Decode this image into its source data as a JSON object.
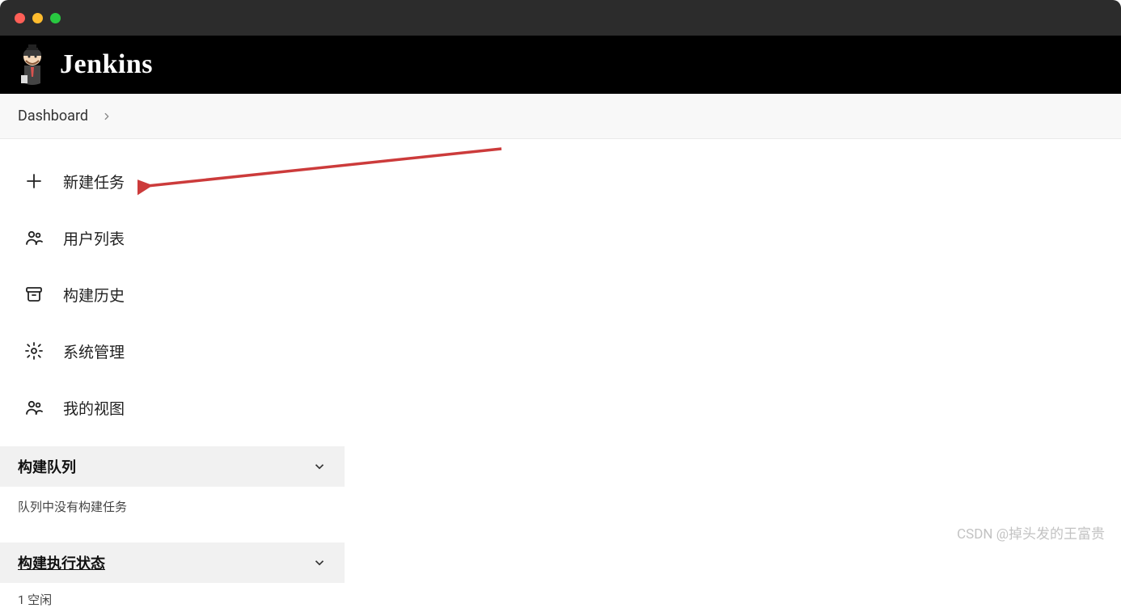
{
  "app": {
    "brand": "Jenkins"
  },
  "breadcrumb": {
    "items": [
      "Dashboard"
    ]
  },
  "sidebar": {
    "items": [
      {
        "label": "新建任务"
      },
      {
        "label": "用户列表"
      },
      {
        "label": "构建历史"
      },
      {
        "label": "系统管理"
      },
      {
        "label": "我的视图"
      }
    ]
  },
  "panels": {
    "queue": {
      "title": "构建队列",
      "empty_text": "队列中没有构建任务"
    },
    "executors": {
      "title": "构建执行状态",
      "row1": "1  空闲"
    }
  },
  "watermark": "CSDN @掉头发的王富贵"
}
